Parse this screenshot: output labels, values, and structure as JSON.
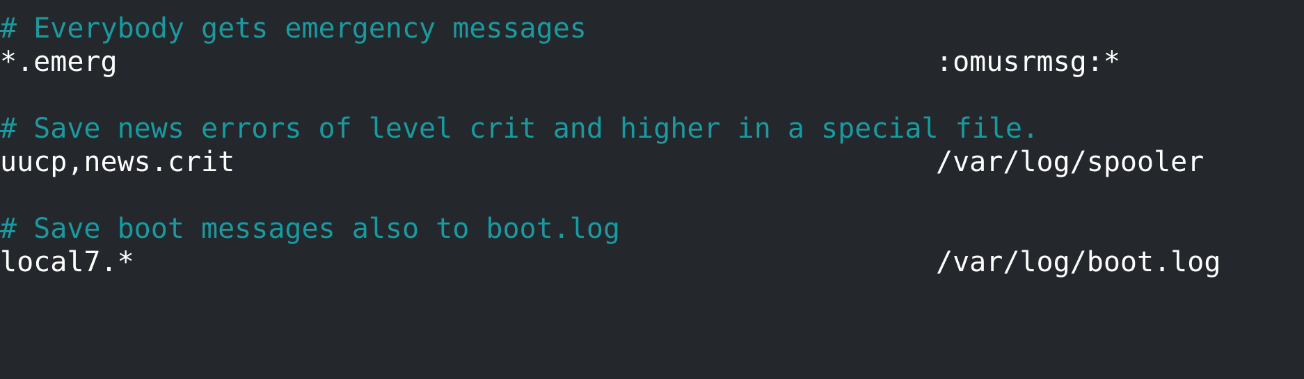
{
  "theme": {
    "background": "#24272b",
    "text": "#ffffff",
    "comment": "#199aa0"
  },
  "rules": [
    {
      "comment": "# Everybody gets emergency messages",
      "selector": "*.emerg",
      "action": ":omusrmsg:*"
    },
    {
      "comment": "# Save news errors of level crit and higher in a special file.",
      "selector": "uucp,news.crit",
      "action": "/var/log/spooler"
    },
    {
      "comment": "# Save boot messages also to boot.log",
      "selector": "local7.*",
      "action": "/var/log/boot.log"
    }
  ]
}
